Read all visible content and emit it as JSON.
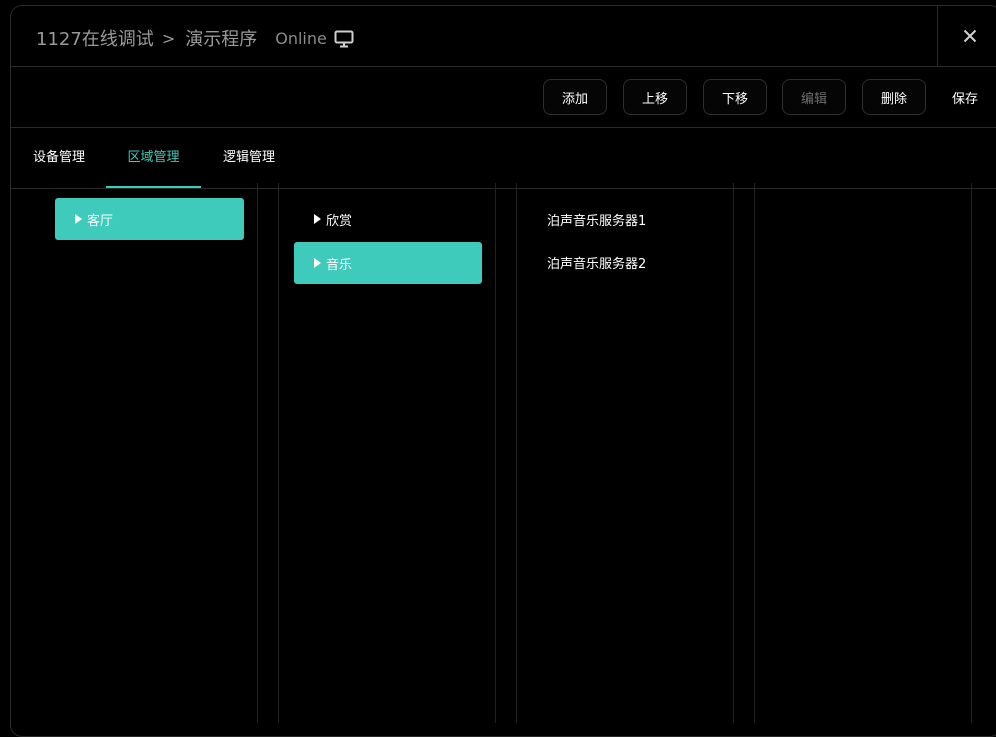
{
  "header": {
    "project": "1127在线调试",
    "separator": ">",
    "program": "演示程序",
    "status": "Online",
    "monitor_icon": "monitor-icon",
    "close_icon": "close-icon"
  },
  "toolbar": {
    "add": "添加",
    "move_up": "上移",
    "move_down": "下移",
    "edit": "编辑",
    "delete": "删除",
    "save": "保存"
  },
  "tabs": [
    {
      "label": "设备管理",
      "active": false
    },
    {
      "label": "区域管理",
      "active": true
    },
    {
      "label": "逻辑管理",
      "active": false
    }
  ],
  "columns": {
    "areas": [
      {
        "label": "客厅",
        "selected": true
      }
    ],
    "subareas": [
      {
        "label": "欣赏",
        "selected": false
      },
      {
        "label": "音乐",
        "selected": true
      }
    ],
    "devices": [
      "泊声音乐服务器1",
      "泊声音乐服务器2"
    ]
  },
  "colors": {
    "accent": "#3ecbbb",
    "background": "#000000",
    "border": "#2a2a2a",
    "muted": "#9a9a9a"
  }
}
